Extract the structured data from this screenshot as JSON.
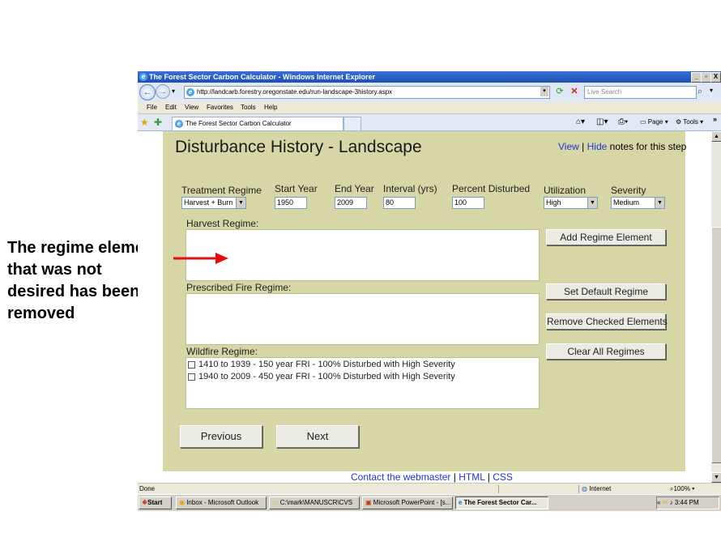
{
  "window": {
    "title": "The Forest Sector Carbon Calculator - Windows Internet Explorer",
    "url": "http://landcarb.forestry.oregonstate.edu/run-landscape-3history.aspx",
    "search_placeholder": "Live Search",
    "minimize": "_",
    "maximize": "3",
    "close": "X"
  },
  "menu": {
    "items": [
      "File",
      "Edit",
      "View",
      "Favorites",
      "Tools",
      "Help"
    ]
  },
  "tabs": {
    "active": "The Forest Sector Carbon Calculator",
    "toolbar_page": "Page",
    "toolbar_tools": "Tools"
  },
  "page": {
    "title": "Disturbance History - Landscape",
    "notes_view": "View",
    "notes_sep": "|",
    "notes_hide": "Hide",
    "notes_suffix": "notes for this step",
    "fields": {
      "treatment_label": "Treatment Regime",
      "treatment_value": "Harvest + Burn",
      "start_label": "Start Year",
      "start_value": "1950",
      "end_label": "End Year",
      "end_value": "2009",
      "interval_label": "Interval (yrs)",
      "interval_value": "80",
      "percent_label": "Percent Disturbed",
      "percent_value": "100",
      "utilization_label": "Utilization",
      "utilization_value": "High",
      "severity_label": "Severity",
      "severity_value": "Medium"
    },
    "harvest_label": "Harvest Regime:",
    "fire_label": "Prescribed Fire Regime:",
    "wildfire_label": "Wildfire Regime:",
    "wildfire_items": [
      "1410 to 1939 - 150 year FRI - 100% Disturbed with High Severity",
      "1940 to 2009 - 450 year FRI - 100% Disturbed with High Severity"
    ],
    "buttons": {
      "add": "Add Regime Element",
      "default": "Set Default Regime",
      "remove": "Remove Checked Elements",
      "clear": "Clear All Regimes",
      "previous": "Previous",
      "next": "Next"
    },
    "footer_contact": "Contact the webmaster",
    "footer_sep1": "|",
    "footer_html": "HTML",
    "footer_sep2": "|",
    "footer_css": "CSS"
  },
  "status": {
    "text": "Done",
    "zone": "Internet",
    "zoom": "100%"
  },
  "taskbar": {
    "start": "Start",
    "items": [
      "Inbox - Microsoft Outlook",
      "C:\\mark\\MANUSCR\\CVS",
      "Microsoft PowerPoint - [s...",
      "The Forest Sector Car..."
    ],
    "clock": "3:44 PM"
  },
  "annotation": {
    "text_lines": [
      "The regime element",
      "that was not",
      "desired has been",
      "removed"
    ],
    "arrow_color": "#e01010"
  }
}
